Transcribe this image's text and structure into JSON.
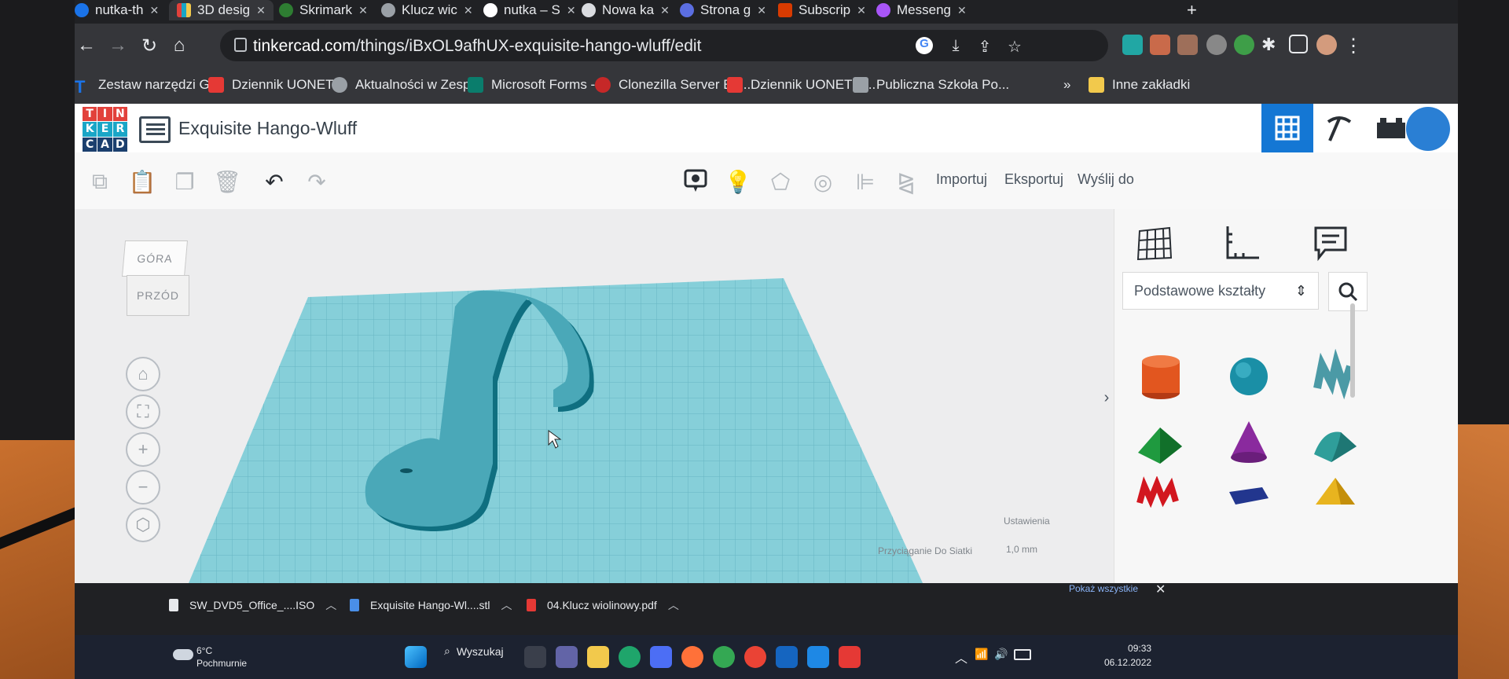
{
  "browser": {
    "tabs": [
      {
        "label": "nutka-th",
        "icon": "tinkercad-icon"
      },
      {
        "label": "3D desig",
        "icon": "tinkercad-grid-icon"
      },
      {
        "label": "Skrimark",
        "icon": "skrimark-icon"
      },
      {
        "label": "Klucz wic",
        "icon": "globe-icon"
      },
      {
        "label": "nutka – S",
        "icon": "google-icon"
      },
      {
        "label": "Nowa ka",
        "icon": "chrome-icon"
      },
      {
        "label": "Strona g",
        "icon": "bing-icon"
      },
      {
        "label": "Subscrip",
        "icon": "office-icon"
      },
      {
        "label": "Messeng",
        "icon": "messenger-icon"
      }
    ],
    "new_tab": "+",
    "url_domain": "tinkercad.com",
    "url_path": "/things/iBxOL9afhUX-exquisite-hango-wluff/edit",
    "bookmarks": [
      {
        "label": "Zestaw narzędzi G...",
        "color": "#1a73e8"
      },
      {
        "label": "Dziennik UONET+",
        "color": "#e53935"
      },
      {
        "label": "Aktualności w Zesp...",
        "color": "#9aa0a6"
      },
      {
        "label": "Microsoft Forms -...",
        "color": "#0a7d6c"
      },
      {
        "label": "Clonezilla Server Ed...",
        "color": "#c62828"
      },
      {
        "label": "Dziennik UONET+-...",
        "color": "#e53935"
      },
      {
        "label": "Publiczna Szkoła Po...",
        "color": "#9aa0a6"
      }
    ],
    "bookmarks_more": "»",
    "other_bookmarks": "Inne zakładki"
  },
  "tinkercad": {
    "logo_letters": [
      "T",
      "I",
      "N",
      "K",
      "E",
      "R",
      "C",
      "A",
      "D"
    ],
    "logo_colors": [
      "#e2413b",
      "#e2413b",
      "#e2413b",
      "#1aa6c7",
      "#1aa6c7",
      "#1aa6c7",
      "#1b3f6e",
      "#1b3f6e",
      "#1b3f6e"
    ],
    "project_title": "Exquisite Hango-Wluff",
    "actions": {
      "import": "Importuj",
      "export": "Eksportuj",
      "send_to": "Wyślij do"
    },
    "viewcube": {
      "top": "GÓRA",
      "front": "PRZÓD"
    },
    "shapes_dropdown": "Podstawowe kształty",
    "workplane": {
      "settings": "Ustawienia",
      "snap_label": "Przyciąganie Do Siatki",
      "snap_value": "1,0 mm"
    },
    "accent": "#1477d4",
    "plate_color": "#7ec8d3"
  },
  "downloads": {
    "items": [
      {
        "label": "SW_DVD5_Office_....ISO"
      },
      {
        "label": "Exquisite Hango-Wl....stl"
      },
      {
        "label": "04.Klucz wiolinowy.pdf"
      }
    ],
    "show_all": "Pokaż wszystkie",
    "close": "✕"
  },
  "taskbar": {
    "temperature": "6°C",
    "condition": "Pochmurnie",
    "search": "Wyszukaj",
    "time": "09:33",
    "date": "06.12.2022"
  }
}
